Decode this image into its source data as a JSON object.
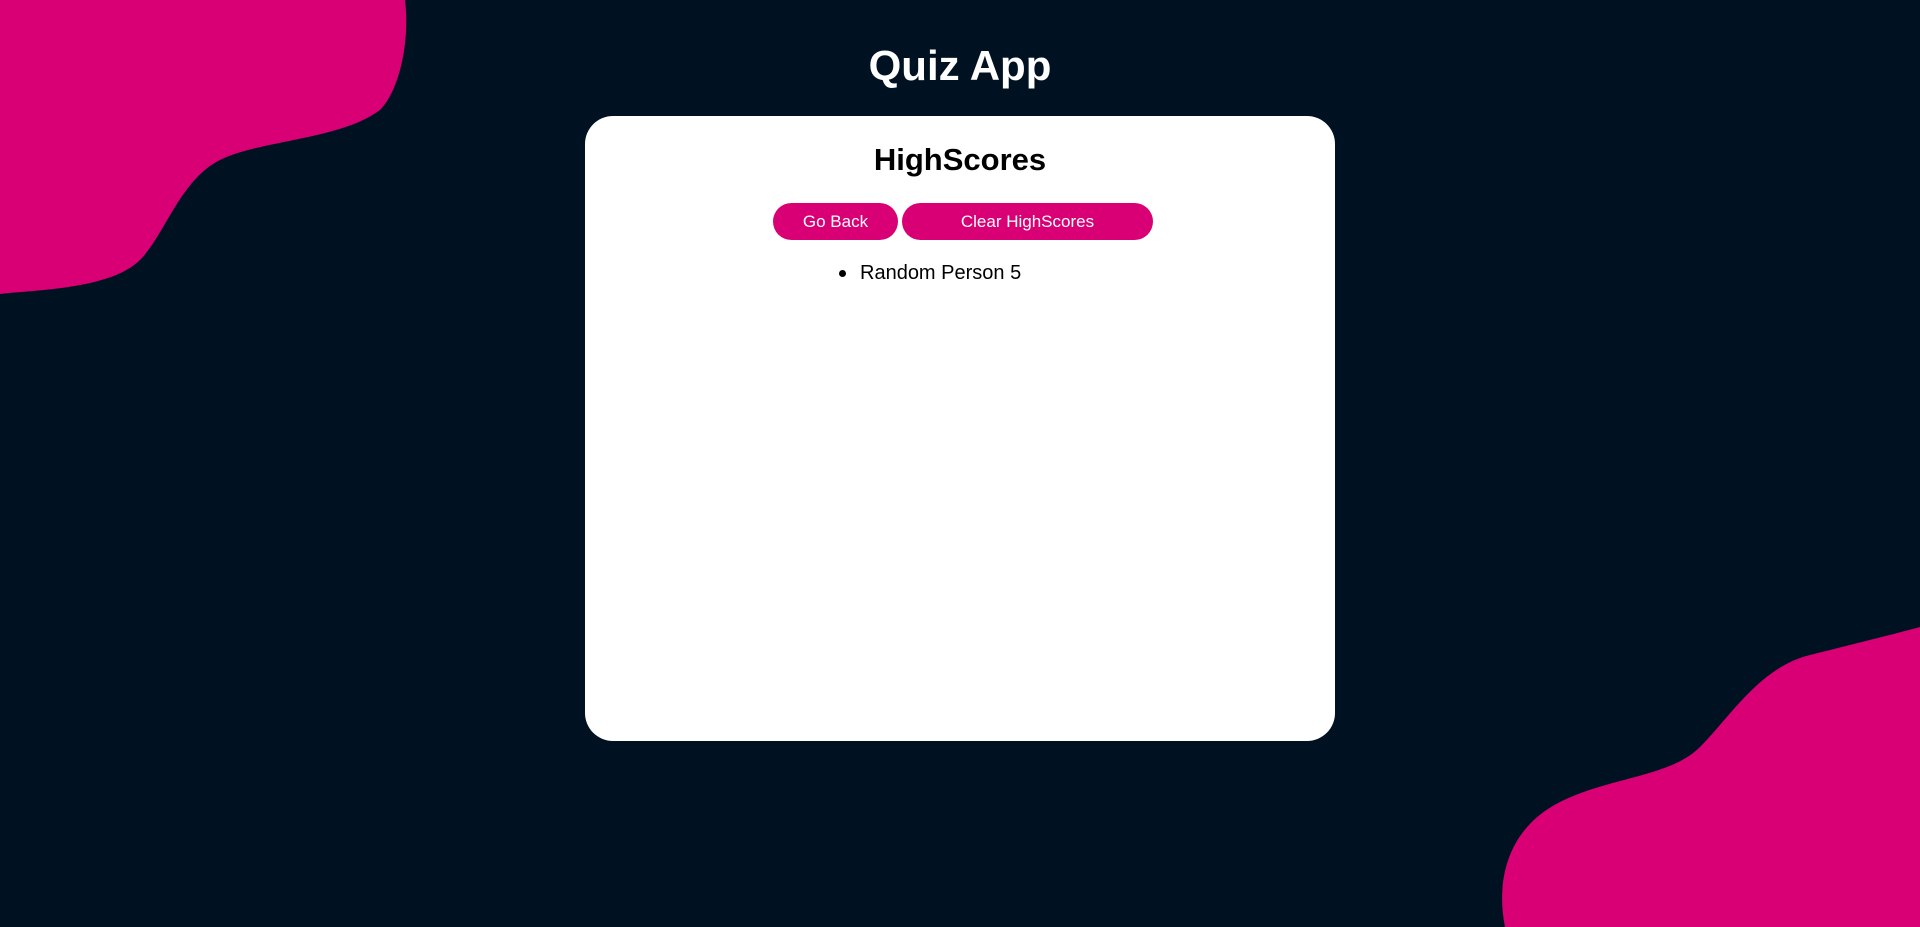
{
  "colors": {
    "background": "#001221",
    "accent": "#d80074",
    "card": "#ffffff"
  },
  "header": {
    "title": "Quiz App"
  },
  "card": {
    "title": "HighScores",
    "buttons": {
      "go_back_label": "Go Back",
      "clear_label": "Clear HighScores"
    },
    "scores": [
      {
        "text": "Random Person 5"
      }
    ]
  }
}
